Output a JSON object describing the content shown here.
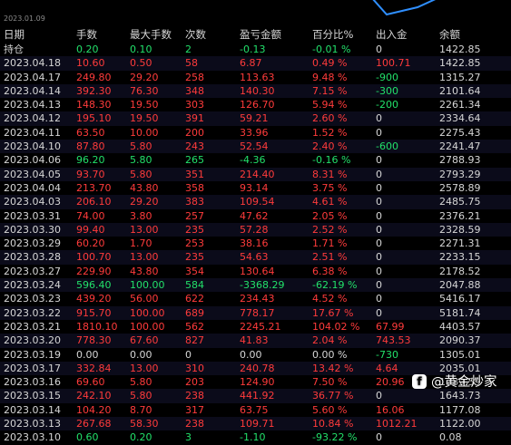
{
  "chart_strip": {
    "date_label": "2023.01.09",
    "line_color": "#2f8fff"
  },
  "header": [
    "日期",
    "手数",
    "最大手数",
    "次数",
    "盈亏金额",
    "百分比%",
    "出入金",
    "余额"
  ],
  "rows": [
    [
      "持仓",
      "0.20",
      "0.10",
      "2",
      "-0.13",
      "-0.01 %",
      "0",
      "1422.85"
    ],
    [
      "2023.04.18",
      "10.60",
      "0.50",
      "58",
      "6.87",
      "0.49 %",
      "100.71",
      "1422.85"
    ],
    [
      "2023.04.17",
      "249.80",
      "29.20",
      "258",
      "113.63",
      "9.48 %",
      "-900",
      "1315.27"
    ],
    [
      "2023.04.14",
      "392.30",
      "76.30",
      "348",
      "140.30",
      "7.15 %",
      "-300",
      "2101.64"
    ],
    [
      "2023.04.13",
      "148.30",
      "19.50",
      "303",
      "126.70",
      "5.94 %",
      "-200",
      "2261.34"
    ],
    [
      "2023.04.12",
      "195.10",
      "19.50",
      "391",
      "59.21",
      "2.60 %",
      "0",
      "2334.64"
    ],
    [
      "2023.04.11",
      "63.50",
      "10.00",
      "200",
      "33.96",
      "1.52 %",
      "0",
      "2275.43"
    ],
    [
      "2023.04.10",
      "87.80",
      "5.80",
      "243",
      "52.54",
      "2.40 %",
      "-600",
      "2241.47"
    ],
    [
      "2023.04.06",
      "96.20",
      "5.80",
      "265",
      "-4.36",
      "-0.16 %",
      "0",
      "2788.93"
    ],
    [
      "2023.04.05",
      "93.70",
      "5.80",
      "351",
      "214.40",
      "8.31 %",
      "0",
      "2793.29"
    ],
    [
      "2023.04.04",
      "213.70",
      "43.80",
      "358",
      "93.14",
      "3.75 %",
      "0",
      "2578.89"
    ],
    [
      "2023.04.03",
      "206.10",
      "29.20",
      "383",
      "109.54",
      "4.61 %",
      "0",
      "2485.75"
    ],
    [
      "2023.03.31",
      "74.00",
      "3.80",
      "257",
      "47.62",
      "2.05 %",
      "0",
      "2376.21"
    ],
    [
      "2023.03.30",
      "99.40",
      "13.00",
      "235",
      "57.28",
      "2.52 %",
      "0",
      "2328.59"
    ],
    [
      "2023.03.29",
      "60.20",
      "1.70",
      "253",
      "38.16",
      "1.71 %",
      "0",
      "2271.31"
    ],
    [
      "2023.03.28",
      "100.70",
      "13.00",
      "235",
      "54.63",
      "2.51 %",
      "0",
      "2233.15"
    ],
    [
      "2023.03.27",
      "229.90",
      "43.80",
      "354",
      "130.64",
      "6.38 %",
      "0",
      "2178.52"
    ],
    [
      "2023.03.24",
      "596.40",
      "100.00",
      "584",
      "-3368.29",
      "-62.19 %",
      "0",
      "2047.88"
    ],
    [
      "2023.03.23",
      "439.20",
      "56.00",
      "622",
      "234.43",
      "4.52 %",
      "0",
      "5416.17"
    ],
    [
      "2023.03.22",
      "915.70",
      "100.00",
      "689",
      "778.17",
      "17.67 %",
      "0",
      "5181.74"
    ],
    [
      "2023.03.21",
      "1810.10",
      "100.00",
      "562",
      "2245.21",
      "104.02 %",
      "67.99",
      "4403.57"
    ],
    [
      "2023.03.20",
      "778.30",
      "67.60",
      "827",
      "41.83",
      "2.04 %",
      "743.53",
      "2090.37"
    ],
    [
      "2023.03.19",
      "0.00",
      "0.00",
      "0",
      "0.00",
      "0.00 %",
      "-730",
      "1305.01"
    ],
    [
      "2023.03.17",
      "332.84",
      "13.00",
      "310",
      "240.78",
      "13.42 %",
      "4.64",
      "2035.01"
    ],
    [
      "2023.03.16",
      "69.60",
      "5.80",
      "203",
      "124.90",
      "7.50 %",
      "20.96",
      "1789.59"
    ],
    [
      "2023.03.15",
      "242.10",
      "5.80",
      "238",
      "441.92",
      "36.77 %",
      "0",
      "1643.73"
    ],
    [
      "2023.03.14",
      "104.20",
      "8.70",
      "317",
      "63.75",
      "5.60 %",
      "16.06",
      "1177.08"
    ],
    [
      "2023.03.13",
      "267.68",
      "58.30",
      "238",
      "109.71",
      "10.84 %",
      "1012.21",
      "1122.00"
    ],
    [
      "2023.03.10",
      "0.60",
      "0.20",
      "3",
      "-1.10",
      "-93.22 %",
      "0",
      "0.08"
    ]
  ],
  "row_colors": [
    "g",
    "r",
    "r",
    "r",
    "r",
    "r",
    "r",
    "r",
    "g",
    "r",
    "r",
    "r",
    "r",
    "r",
    "r",
    "r",
    "r",
    "g",
    "r",
    "r",
    "r",
    "r",
    "w",
    "r",
    "r",
    "r",
    "r",
    "r",
    "g"
  ],
  "watermark": {
    "icon": "facebook-icon",
    "glyph": "f",
    "text": "@黄金炒家"
  },
  "colors": {
    "positive": "#ff3b3b",
    "negative": "#22e06a",
    "neutral": "#d6d6d6"
  }
}
